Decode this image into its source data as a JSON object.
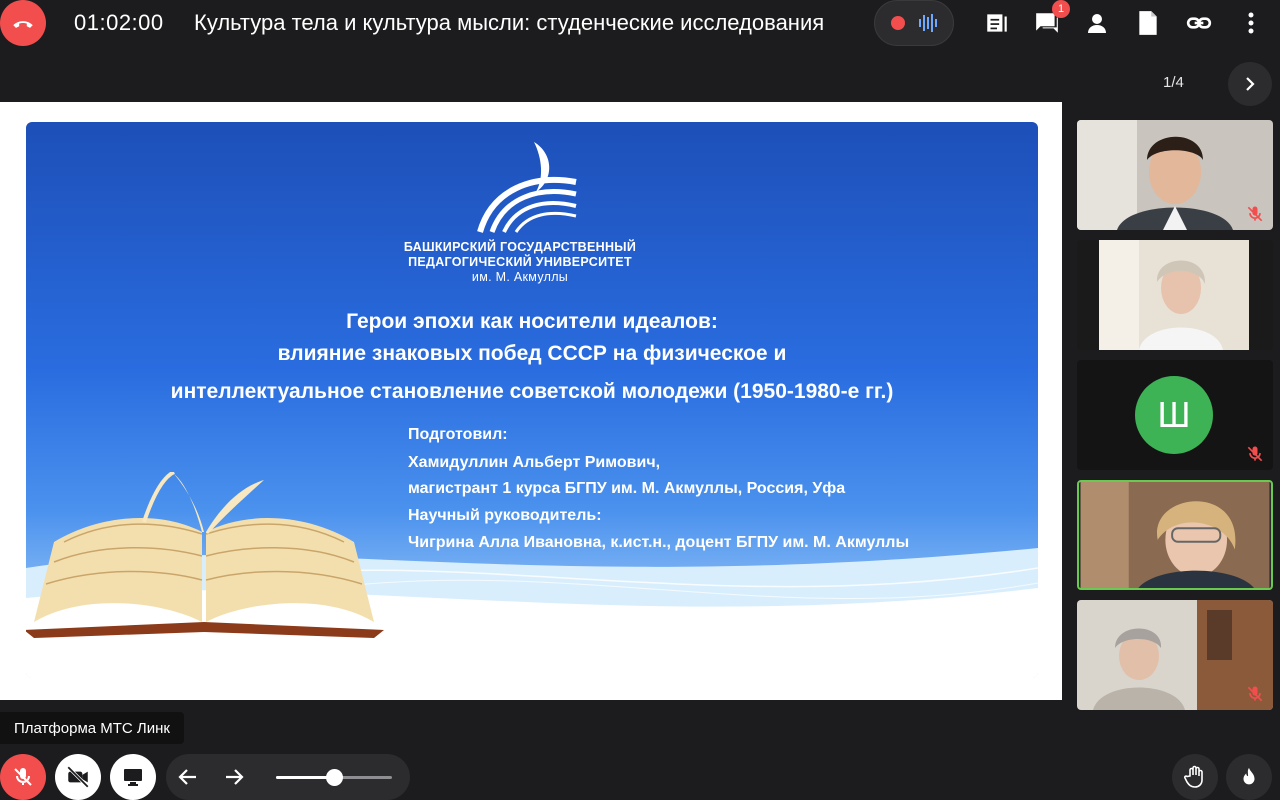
{
  "header": {
    "timer": "01:02:00",
    "title": "Культура тела и культура мысли: студенческие исследования",
    "chat_badge": "1"
  },
  "presentation": {
    "page_indicator": "1/4",
    "slide": {
      "university_lines": [
        "БАШКИРСКИЙ ГОСУДАРСТВЕННЫЙ",
        "ПЕДАГОГИЧЕСКИЙ УНИВЕРСИТЕТ",
        "им. М. Акмуллы"
      ],
      "heading_lines": [
        "Герои эпохи как носители идеалов:",
        "влияние знаковых побед СССР на физическое и",
        "интеллектуальное становление советской молодежи (1950-1980-е гг.)"
      ],
      "info_lines": [
        "Подготовил:",
        "Хамидуллин Альберт Римович,",
        "магистрант 1 курса БГПУ им. М. Акмуллы, Россия, Уфа",
        "Научный руководитель:",
        "Чигрина Алла Ивановна, к.ист.н., доцент БГПУ им. М. Акмуллы"
      ]
    }
  },
  "participants": [
    {
      "type": "video",
      "muted": true
    },
    {
      "type": "video",
      "muted": false
    },
    {
      "type": "avatar",
      "initial": "Ш",
      "muted": true
    },
    {
      "type": "video",
      "muted": false,
      "speaking": true
    },
    {
      "type": "video",
      "muted": true
    }
  ],
  "footer": {
    "platform_label": "Платформа МТС Линк",
    "zoom_level": 0.5
  },
  "colors": {
    "accent_red": "#f24e4e",
    "avatar_green": "#3db356",
    "speaking_border": "#6ac94f"
  }
}
